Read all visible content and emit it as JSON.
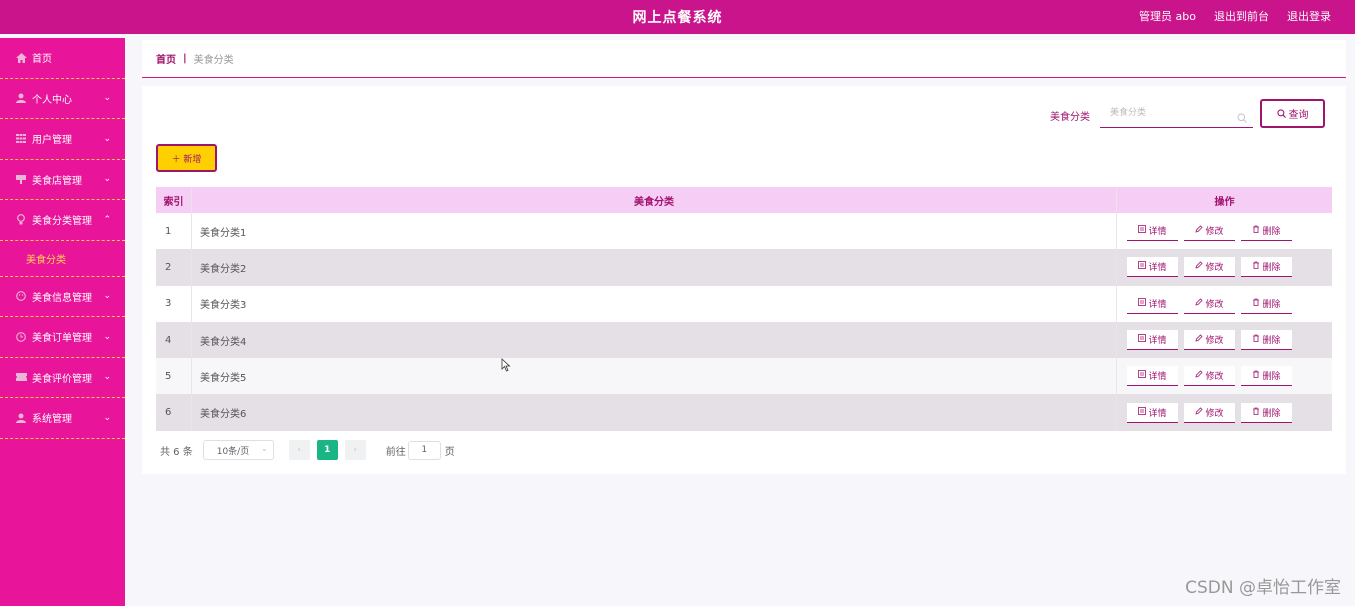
{
  "header": {
    "title": "网上点餐系统",
    "admin_label": "管理员 abo",
    "back_front": "退出到前台",
    "logout": "退出登录"
  },
  "sidebar": {
    "items": [
      {
        "label": "首页",
        "icon": "home-icon"
      },
      {
        "label": "个人中心",
        "icon": "user-icon"
      },
      {
        "label": "用户管理",
        "icon": "grid-icon"
      },
      {
        "label": "美食店管理",
        "icon": "store-icon"
      },
      {
        "label": "美食分类管理",
        "icon": "bulb-icon"
      },
      {
        "label": "美食信息管理",
        "icon": "face-icon"
      },
      {
        "label": "美食订单管理",
        "icon": "clock-icon"
      },
      {
        "label": "美食评价管理",
        "icon": "ticket-icon"
      },
      {
        "label": "系统管理",
        "icon": "user-icon"
      }
    ],
    "submenu_active": "美食分类"
  },
  "breadcrumb": {
    "home": "首页",
    "sep": "|",
    "current": "美食分类"
  },
  "search": {
    "label": "美食分类",
    "placeholder": "美食分类",
    "button": "查询"
  },
  "toolbar": {
    "add_label": "＋ 新增"
  },
  "table": {
    "headers": [
      "索引",
      "美食分类",
      "操作"
    ],
    "rows": [
      {
        "index": "1",
        "name": "美食分类1"
      },
      {
        "index": "2",
        "name": "美食分类2"
      },
      {
        "index": "3",
        "name": "美食分类3"
      },
      {
        "index": "4",
        "name": "美食分类4"
      },
      {
        "index": "5",
        "name": "美食分类5"
      },
      {
        "index": "6",
        "name": "美食分类6"
      }
    ],
    "ops": {
      "detail": "详情",
      "edit": "修改",
      "delete": "删除"
    }
  },
  "pagination": {
    "total": "共 6 条",
    "page_size": "10条/页",
    "current_page": "1",
    "goto_label": "前往",
    "goto_value": "1",
    "page_unit": "页"
  },
  "watermark": "CSDN @卓怡工作室",
  "colors": {
    "header": "#c9148c",
    "sidebar": "#e8149a",
    "accent": "#a0136e",
    "add": "#ffd000",
    "page_active": "#19b585"
  }
}
